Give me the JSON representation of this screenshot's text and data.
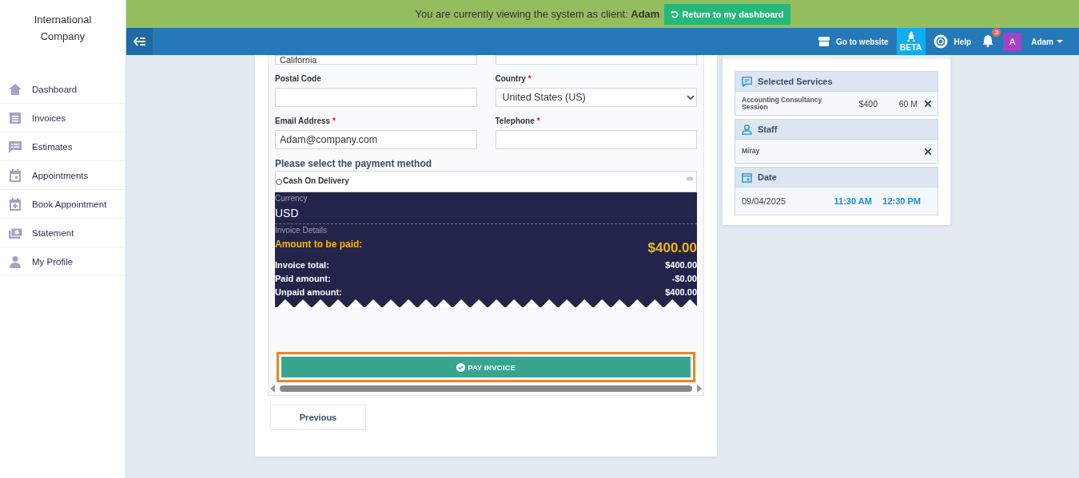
{
  "sidebar": {
    "company": "International Company",
    "items": [
      {
        "label": "Dashboard"
      },
      {
        "label": "Invoices"
      },
      {
        "label": "Estimates"
      },
      {
        "label": "Appointments"
      },
      {
        "label": "Book Appointment"
      },
      {
        "label": "Statement"
      },
      {
        "label": "My Profile"
      }
    ]
  },
  "banner": {
    "text": "You are currently viewing the system as client:",
    "client": "Adam",
    "button": "Return to my dashboard"
  },
  "navbar": {
    "go_to_website": "Go to website",
    "beta": "BETA",
    "help": "Help",
    "notifications": "3",
    "avatar": "A",
    "user": "Adam"
  },
  "form": {
    "top_field_value": "California",
    "fields": [
      {
        "label": "Postal Code",
        "kind": "input"
      },
      {
        "label": "Country",
        "required_mark": "*",
        "kind": "select",
        "value": "United States (US)"
      },
      {
        "label": "Email Address",
        "required_mark": "*",
        "kind": "input",
        "value": "Adam@company.com"
      },
      {
        "label": "Telephone",
        "required_mark": "*",
        "kind": "input"
      }
    ],
    "payment_heading": "Please select the payment method",
    "payment_options": [
      {
        "label": "Cash On Delivery",
        "selected": false
      }
    ],
    "currency_label": "Currency",
    "currency": "USD",
    "details_label": "Invoice Details",
    "amount_label": "Amount to be paid:",
    "amount": "$400.00",
    "lines": [
      {
        "label": "Invoice total:",
        "value": "$400.00"
      },
      {
        "label": "Paid amount:",
        "value": "-$0.00"
      },
      {
        "label": "Unpaid amount:",
        "value": "$400.00"
      }
    ],
    "pay_button": "PAY INVOICE",
    "previous_button": "Previous"
  },
  "summary": {
    "services_heading": "Selected Services",
    "service": {
      "name": "Accounting Consultancy Session",
      "price": "$400",
      "duration": "60 M"
    },
    "staff_heading": "Staff",
    "staff": "Miray",
    "date_heading": "Date",
    "date": "09/04/2025",
    "start": "11:30 AM",
    "end": "12:30 PM"
  }
}
